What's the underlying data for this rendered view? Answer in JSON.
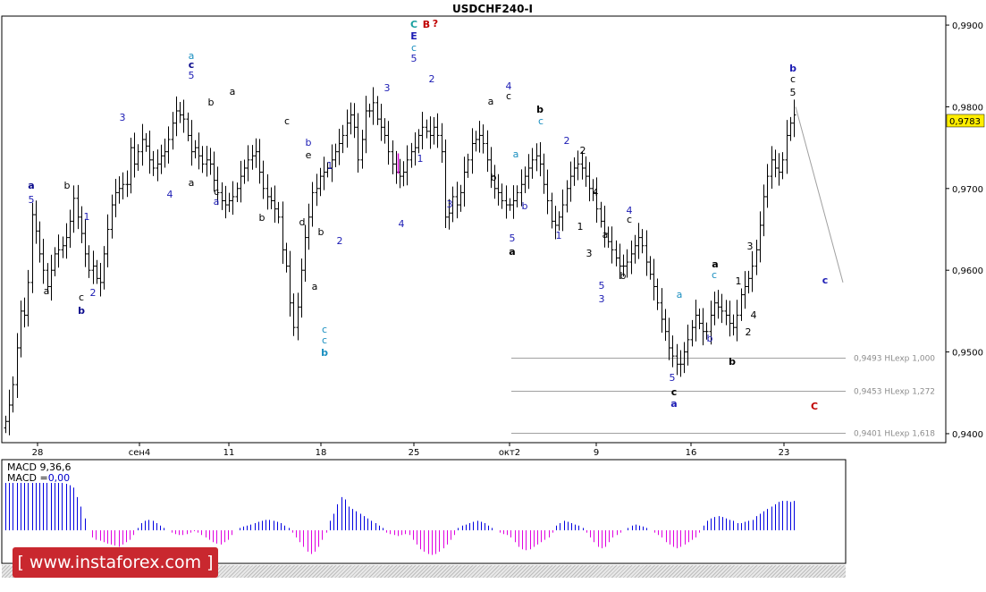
{
  "chart_data": {
    "type": "ohlc-bar",
    "title": "USDCHF240-I",
    "current_price": "0,9783",
    "y_ticks": [
      "0,9900",
      "0,9800",
      "0,9700",
      "0,9600",
      "0,9500",
      "0,9400"
    ],
    "y_tick_values": [
      0.99,
      0.98,
      0.97,
      0.96,
      0.95,
      0.94
    ],
    "ylim": [
      0.9389,
      0.9911
    ],
    "x_tick_labels": [
      "28",
      "сен4",
      "11",
      "18",
      "25",
      "окт2",
      "9",
      "16",
      "23"
    ],
    "fibo_levels": [
      {
        "price": 0.9493,
        "label": "0,9493 HLexp 1,000"
      },
      {
        "price": 0.9453,
        "label": "0,9453 HLexp 1,272"
      },
      {
        "price": 0.9401,
        "label": "0,9401 HLexp 1,618"
      }
    ],
    "series": [
      {
        "name": "USDCHF240-I",
        "values": [
          0.9415,
          0.9435,
          0.946,
          0.9505,
          0.955,
          0.9545,
          0.9585,
          0.9668,
          0.9648,
          0.962,
          0.96,
          0.958,
          0.96,
          0.962,
          0.9625,
          0.963,
          0.964,
          0.966,
          0.9688,
          0.9665,
          0.9645,
          0.962,
          0.96,
          0.9605,
          0.959,
          0.9585,
          0.962,
          0.965,
          0.968,
          0.9695,
          0.97,
          0.9705,
          0.9705,
          0.975,
          0.973,
          0.9745,
          0.976,
          0.9752,
          0.9735,
          0.9725,
          0.973,
          0.974,
          0.9745,
          0.976,
          0.978,
          0.9795,
          0.979,
          0.9785,
          0.9765,
          0.9745,
          0.975,
          0.974,
          0.973,
          0.9735,
          0.973,
          0.971,
          0.9695,
          0.9685,
          0.968,
          0.9685,
          0.969,
          0.97,
          0.9715,
          0.9725,
          0.9735,
          0.974,
          0.9745,
          0.972,
          0.97,
          0.969,
          0.9685,
          0.9675,
          0.9665,
          0.9625,
          0.9605,
          0.956,
          0.953,
          0.9555,
          0.96,
          0.964,
          0.9665,
          0.9695,
          0.97,
          0.9715,
          0.972,
          0.9725,
          0.9735,
          0.9745,
          0.9755,
          0.9765,
          0.978,
          0.979,
          0.9775,
          0.9735,
          0.976,
          0.9795,
          0.9795,
          0.9805,
          0.9785,
          0.9775,
          0.9765,
          0.9745,
          0.973,
          0.972,
          0.9715,
          0.972,
          0.9735,
          0.9745,
          0.975,
          0.9765,
          0.9775,
          0.977,
          0.9765,
          0.9775,
          0.9765,
          0.9745,
          0.9665,
          0.967,
          0.969,
          0.968,
          0.9695,
          0.972,
          0.9735,
          0.9755,
          0.976,
          0.9765,
          0.9755,
          0.9735,
          0.9715,
          0.97,
          0.9695,
          0.9685,
          0.968,
          0.968,
          0.9685,
          0.9695,
          0.9705,
          0.9715,
          0.9725,
          0.9735,
          0.974,
          0.973,
          0.9705,
          0.9685,
          0.966,
          0.9655,
          0.9665,
          0.968,
          0.97,
          0.9715,
          0.9725,
          0.973,
          0.9725,
          0.9715,
          0.97,
          0.9695,
          0.9675,
          0.966,
          0.9645,
          0.9635,
          0.9625,
          0.9615,
          0.9605,
          0.9605,
          0.961,
          0.962,
          0.963,
          0.964,
          0.963,
          0.961,
          0.9595,
          0.958,
          0.956,
          0.954,
          0.9525,
          0.9505,
          0.9495,
          0.9485,
          0.9485,
          0.95,
          0.9515,
          0.953,
          0.9545,
          0.9535,
          0.9525,
          0.9525,
          0.9545,
          0.956,
          0.9555,
          0.955,
          0.9545,
          0.9535,
          0.953,
          0.9545,
          0.957,
          0.958,
          0.959,
          0.9605,
          0.9625,
          0.9655,
          0.969,
          0.9715,
          0.9735,
          0.9725,
          0.972,
          0.9735,
          0.9765,
          0.978,
          0.979
        ]
      }
    ],
    "wave_labels": [
      {
        "text": "a",
        "color": "#0a0a8c",
        "bold": true
      },
      {
        "text": "5",
        "color": "#1c1cb4",
        "bold": false
      },
      {
        "text": "a",
        "color": "#000000",
        "bold": false
      },
      {
        "text": "b",
        "color": "#000000",
        "bold": false
      },
      {
        "text": "c",
        "color": "#000000",
        "bold": false
      },
      {
        "text": "b",
        "color": "#0a0a8c",
        "bold": true
      },
      {
        "text": "1",
        "color": "#1c1cb4",
        "bold": false
      },
      {
        "text": "2",
        "color": "#1c1cb4",
        "bold": false
      },
      {
        "text": "3",
        "color": "#1c1cb4",
        "bold": false
      },
      {
        "text": "4",
        "color": "#1c1cb4",
        "bold": false
      },
      {
        "text": "a",
        "color": "#1a8fc0",
        "bold": false
      },
      {
        "text": "c",
        "color": "#0a0a8c",
        "bold": true
      },
      {
        "text": "5",
        "color": "#1c1cb4",
        "bold": false
      },
      {
        "text": "b",
        "color": "#000000",
        "bold": false
      },
      {
        "text": "a",
        "color": "#000000",
        "bold": false
      },
      {
        "text": "a",
        "color": "#000000",
        "bold": false
      },
      {
        "text": "c",
        "color": "#000000",
        "bold": false
      },
      {
        "text": "a",
        "color": "#1c1cb4",
        "bold": false
      },
      {
        "text": "b",
        "color": "#000000",
        "bold": false
      },
      {
        "text": "c",
        "color": "#000000",
        "bold": false
      },
      {
        "text": "b",
        "color": "#1c1cb4",
        "bold": false
      },
      {
        "text": "e",
        "color": "#000000",
        "bold": false
      },
      {
        "text": "d",
        "color": "#000000",
        "bold": false
      },
      {
        "text": "b",
        "color": "#000000",
        "bold": false
      },
      {
        "text": "a",
        "color": "#000000",
        "bold": false
      },
      {
        "text": "c",
        "color": "#1a8fc0",
        "bold": false
      },
      {
        "text": "c",
        "color": "#1a8fc0",
        "bold": false
      },
      {
        "text": "b",
        "color": "#1a8fc0",
        "bold": true
      },
      {
        "text": "1",
        "color": "#1c1cb4",
        "bold": false
      },
      {
        "text": "2",
        "color": "#1c1cb4",
        "bold": false
      },
      {
        "text": "3",
        "color": "#1c1cb4",
        "bold": false
      },
      {
        "text": "4",
        "color": "#1c1cb4",
        "bold": false
      },
      {
        "text": "C",
        "color": "#1aa0a0",
        "bold": true
      },
      {
        "text": "B",
        "color": "#c00000",
        "bold": true
      },
      {
        "text": "?",
        "color": "#c00000",
        "bold": true
      },
      {
        "text": "E",
        "color": "#1c1cb4",
        "bold": true
      },
      {
        "text": "c",
        "color": "#1a8fc0",
        "bold": false
      },
      {
        "text": "5",
        "color": "#1c1cb4",
        "bold": false
      },
      {
        "text": "1",
        "color": "#1c1cb4",
        "bold": false
      },
      {
        "text": "2",
        "color": "#1c1cb4",
        "bold": false
      },
      {
        "text": "3",
        "color": "#1c1cb4",
        "bold": false
      },
      {
        "text": "4",
        "color": "#1c1cb4",
        "bold": false
      },
      {
        "text": "c",
        "color": "#000000",
        "bold": false
      },
      {
        "text": "a",
        "color": "#000000",
        "bold": false
      },
      {
        "text": "b",
        "color": "#000000",
        "bold": false
      },
      {
        "text": "5",
        "color": "#1c1cb4",
        "bold": false
      },
      {
        "text": "a",
        "color": "#000000",
        "bold": true
      },
      {
        "text": "a",
        "color": "#1a8fc0",
        "bold": false
      },
      {
        "text": "b",
        "color": "#1c1cb4",
        "bold": false
      },
      {
        "text": "b",
        "color": "#000000",
        "bold": true
      },
      {
        "text": "c",
        "color": "#1a8fc0",
        "bold": false
      },
      {
        "text": "1",
        "color": "#1c1cb4",
        "bold": false
      },
      {
        "text": "2",
        "color": "#1c1cb4",
        "bold": false
      },
      {
        "text": "2",
        "color": "#000000",
        "bold": false
      },
      {
        "text": "1",
        "color": "#000000",
        "bold": false
      },
      {
        "text": "4",
        "color": "#000000",
        "bold": false
      },
      {
        "text": "3",
        "color": "#000000",
        "bold": false
      },
      {
        "text": "a",
        "color": "#000000",
        "bold": false
      },
      {
        "text": "b",
        "color": "#000000",
        "bold": false
      },
      {
        "text": "5",
        "color": "#1c1cb4",
        "bold": false
      },
      {
        "text": "3",
        "color": "#1c1cb4",
        "bold": false
      },
      {
        "text": "4",
        "color": "#1c1cb4",
        "bold": false
      },
      {
        "text": "c",
        "color": "#000000",
        "bold": false
      },
      {
        "text": "a",
        "color": "#1a8fc0",
        "bold": false
      },
      {
        "text": "5",
        "color": "#1c1cb4",
        "bold": false
      },
      {
        "text": "c",
        "color": "#000000",
        "bold": true
      },
      {
        "text": "a",
        "color": "#1c1cb4",
        "bold": true
      },
      {
        "text": "b",
        "color": "#1c1cb4",
        "bold": false
      },
      {
        "text": "a",
        "color": "#000000",
        "bold": true
      },
      {
        "text": "c",
        "color": "#1a8fc0",
        "bold": false
      },
      {
        "text": "b",
        "color": "#000000",
        "bold": true
      },
      {
        "text": "1",
        "color": "#000000",
        "bold": false
      },
      {
        "text": "2",
        "color": "#000000",
        "bold": false
      },
      {
        "text": "3",
        "color": "#000000",
        "bold": false
      },
      {
        "text": "4",
        "color": "#000000",
        "bold": false
      },
      {
        "text": "b",
        "color": "#1c1cb4",
        "bold": true
      },
      {
        "text": "c",
        "color": "#000000",
        "bold": false
      },
      {
        "text": "5",
        "color": "#000000",
        "bold": false
      },
      {
        "text": "c",
        "color": "#1c1cb4",
        "bold": true
      },
      {
        "text": "C",
        "color": "#c00000",
        "bold": true
      }
    ],
    "projection": {
      "from_price": 0.98,
      "to_price": 0.9585
    },
    "macd": {
      "label": "MACD 9,36,6",
      "value_prefix": "MACD =",
      "value_text": "0,00",
      "value_color": "#0000cc",
      "values": [
        1.0,
        1.0,
        1.0,
        1.0,
        1.0,
        1.0,
        1.0,
        1.0,
        1.0,
        1.0,
        1.0,
        1.0,
        1.0,
        1.0,
        1.0,
        1.0,
        0.98,
        0.95,
        0.9,
        0.7,
        0.5,
        0.25,
        0.0,
        -0.15,
        -0.2,
        -0.22,
        -0.25,
        -0.28,
        -0.3,
        -0.32,
        -0.35,
        -0.3,
        -0.25,
        -0.2,
        -0.1,
        0.05,
        0.15,
        0.2,
        0.22,
        0.2,
        0.15,
        0.1,
        0.05,
        0.0,
        -0.05,
        -0.08,
        -0.1,
        -0.1,
        -0.08,
        -0.05,
        -0.02,
        -0.05,
        -0.1,
        -0.15,
        -0.2,
        -0.25,
        -0.28,
        -0.3,
        -0.25,
        -0.2,
        -0.1,
        0.0,
        0.05,
        0.08,
        0.1,
        0.12,
        0.15,
        0.18,
        0.2,
        0.22,
        0.22,
        0.2,
        0.18,
        0.15,
        0.1,
        0.05,
        -0.05,
        -0.15,
        -0.25,
        -0.35,
        -0.45,
        -0.5,
        -0.45,
        -0.35,
        -0.2,
        -0.05,
        0.2,
        0.35,
        0.55,
        0.7,
        0.65,
        0.5,
        0.45,
        0.4,
        0.35,
        0.3,
        0.25,
        0.2,
        0.15,
        0.1,
        0.05,
        -0.05,
        -0.08,
        -0.1,
        -0.12,
        -0.1,
        -0.08,
        -0.1,
        -0.2,
        -0.3,
        -0.4,
        -0.45,
        -0.5,
        -0.52,
        -0.5,
        -0.45,
        -0.38,
        -0.3,
        -0.2,
        -0.1,
        0.05,
        0.1,
        0.12,
        0.15,
        0.18,
        0.2,
        0.18,
        0.15,
        0.1,
        0.05,
        0.0,
        -0.05,
        -0.08,
        -0.1,
        -0.15,
        -0.25,
        -0.35,
        -0.4,
        -0.42,
        -0.4,
        -0.35,
        -0.3,
        -0.25,
        -0.2,
        -0.15,
        -0.05,
        0.1,
        0.15,
        0.2,
        0.18,
        0.15,
        0.12,
        0.1,
        0.05,
        -0.05,
        -0.15,
        -0.25,
        -0.35,
        -0.38,
        -0.35,
        -0.25,
        -0.15,
        -0.1,
        -0.05,
        0.0,
        0.05,
        0.1,
        0.12,
        0.1,
        0.08,
        0.05,
        0.0,
        -0.05,
        -0.1,
        -0.15,
        -0.25,
        -0.3,
        -0.35,
        -0.38,
        -0.35,
        -0.3,
        -0.25,
        -0.2,
        -0.15,
        -0.05,
        0.1,
        0.2,
        0.25,
        0.28,
        0.3,
        0.28,
        0.25,
        0.22,
        0.2,
        0.15,
        0.15,
        0.18,
        0.2,
        0.22,
        0.3,
        0.35,
        0.4,
        0.45,
        0.5,
        0.55,
        0.6,
        0.62,
        0.62,
        0.6,
        0.62
      ]
    }
  },
  "watermark": {
    "text": "www.instaforex.com",
    "brand_color": "#c9282f"
  }
}
